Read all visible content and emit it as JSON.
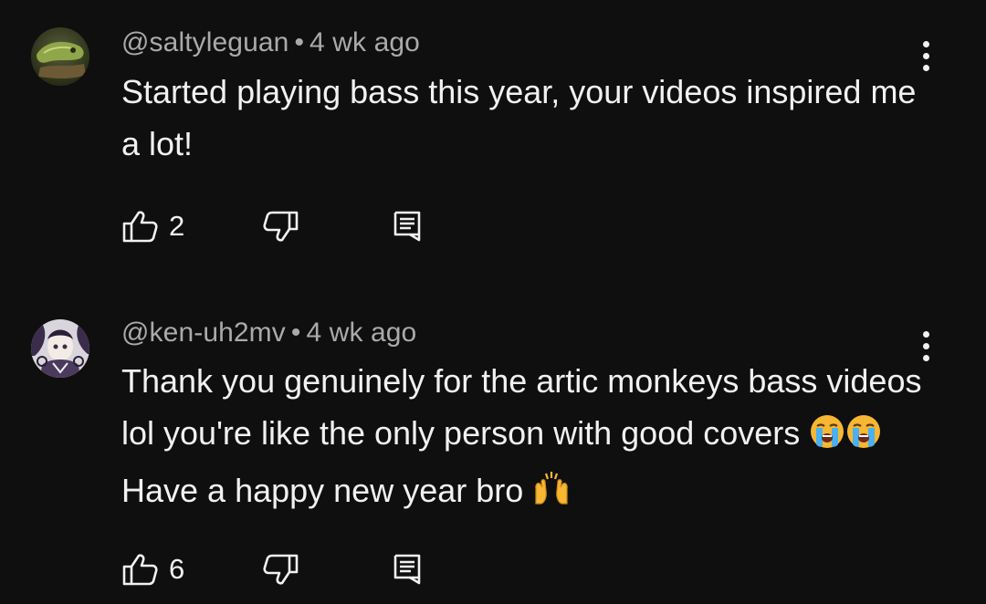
{
  "colors": {
    "background": "#0f0f0f",
    "text": "#f1f1f1",
    "meta": "#aaaaaa"
  },
  "comments": [
    {
      "handle": "@saltyleguan",
      "separator": "•",
      "age": "4 wk ago",
      "text": "Started playing bass this year, your videos inspired me a lot!",
      "likes": "2",
      "icons": {
        "avatar": "chameleon-avatar",
        "like": "thumbs-up-icon",
        "dislike": "thumbs-down-icon",
        "reply": "reply-comment-icon",
        "more": "more-vert-icon"
      }
    },
    {
      "handle": "@ken-uh2mv",
      "separator": "•",
      "age": "4 wk ago",
      "text_part1": "Thank you genuinely for the artic monkeys bass videos lol you're like the only person with good covers",
      "text_part2": "Have a happy new year bro",
      "emojis": [
        "loudly-crying-face",
        "loudly-crying-face",
        "raising-hands"
      ],
      "likes": "6",
      "icons": {
        "avatar": "anime-character-avatar",
        "like": "thumbs-up-icon",
        "dislike": "thumbs-down-icon",
        "reply": "reply-comment-icon",
        "more": "more-vert-icon"
      }
    }
  ]
}
